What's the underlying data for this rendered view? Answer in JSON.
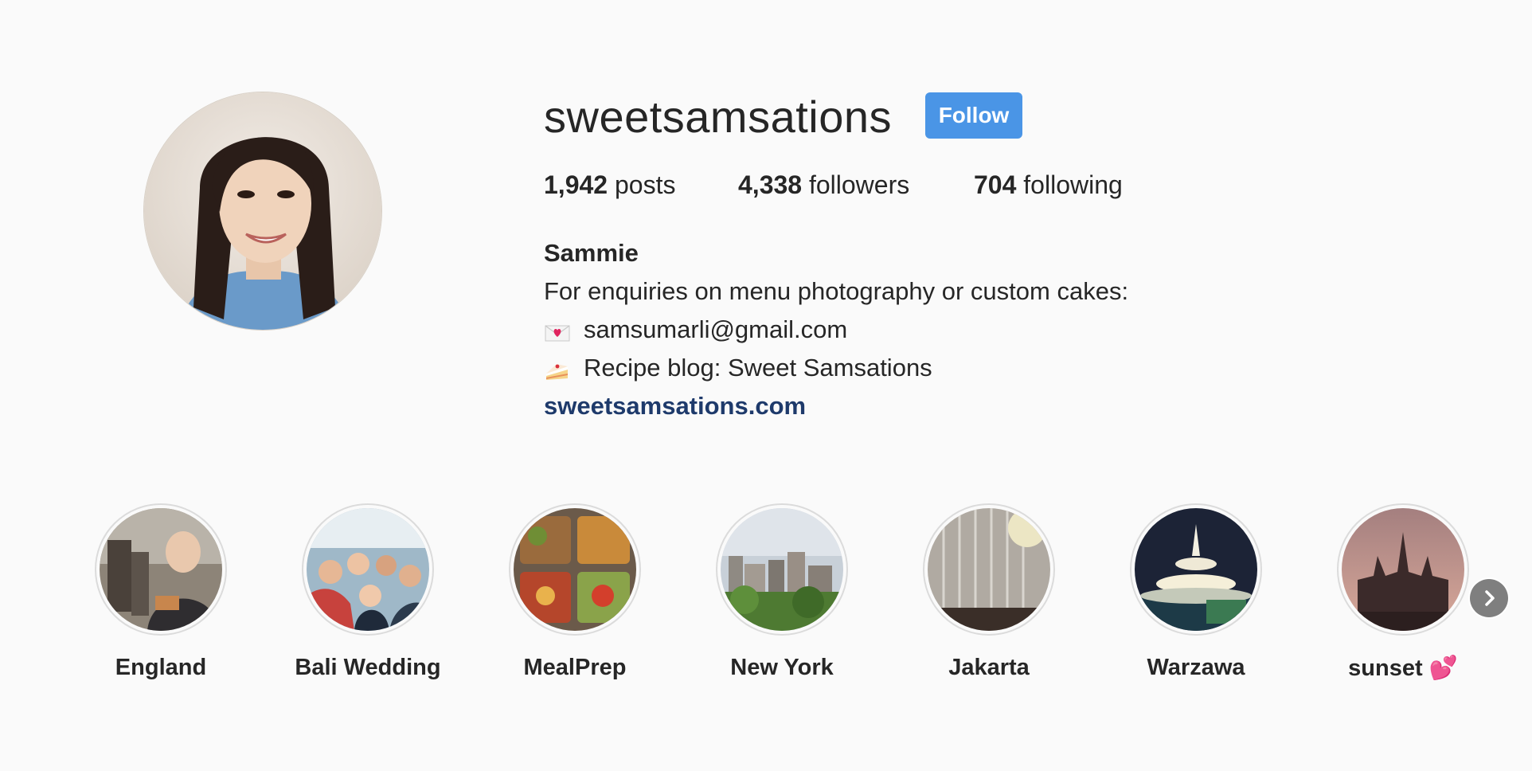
{
  "profile": {
    "username": "sweetsamsations",
    "follow_label": "Follow",
    "stats": [
      {
        "count": "1,942",
        "label": "posts"
      },
      {
        "count": "4,338",
        "label": "followers"
      },
      {
        "count": "704",
        "label": "following"
      }
    ],
    "bio": {
      "full_name": "Sammie",
      "line1": "For enquiries on menu photography or custom cakes:",
      "email_icon": "love-letter-emoji",
      "email": "samsumarli@gmail.com",
      "blog_icon": "cake-slice-emoji",
      "blog": "Recipe blog: Sweet Samsations",
      "website": "sweetsamsations.com"
    }
  },
  "highlights": [
    {
      "label": "England"
    },
    {
      "label": "Bali Wedding"
    },
    {
      "label": "MealPrep"
    },
    {
      "label": "New York"
    },
    {
      "label": "Jakarta"
    },
    {
      "label": "Warzawa"
    },
    {
      "label": "sunset 💕"
    }
  ],
  "colors": {
    "background": "#fafafa",
    "follow_button": "#4a95e6",
    "link": "#1e3a6b",
    "text": "#262626"
  },
  "icons": {
    "next": "chevron-right-icon"
  }
}
